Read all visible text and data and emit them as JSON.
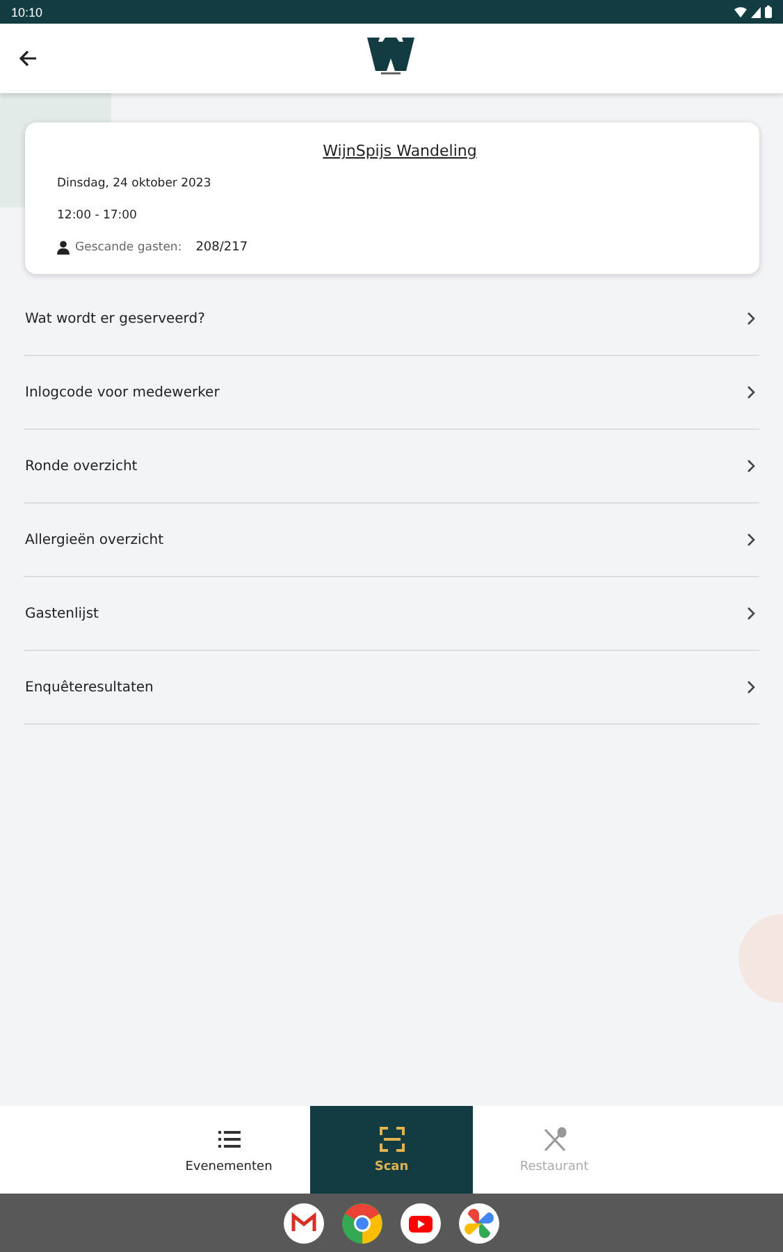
{
  "status_bar": {
    "time": "10:10"
  },
  "event": {
    "title": "WijnSpijs Wandeling",
    "date": "Dinsdag, 24 oktober 2023",
    "time": "12:00 - 17:00",
    "guests_label": "Gescande gasten:",
    "guests_value": "208/217"
  },
  "menu": [
    {
      "label": "Wat wordt er geserveerd?"
    },
    {
      "label": "Inlogcode voor medewerker"
    },
    {
      "label": "Ronde overzicht"
    },
    {
      "label": "Allergieën overzicht"
    },
    {
      "label": "Gastenlijst"
    },
    {
      "label": "Enquêteresultaten"
    }
  ],
  "bottom_nav": [
    {
      "label": "Evenementen",
      "kind": "list",
      "selected": false,
      "disabled": false
    },
    {
      "label": "Scan",
      "kind": "scan",
      "selected": true,
      "disabled": false
    },
    {
      "label": "Restaurant",
      "kind": "cutlery",
      "selected": false,
      "disabled": true
    }
  ]
}
